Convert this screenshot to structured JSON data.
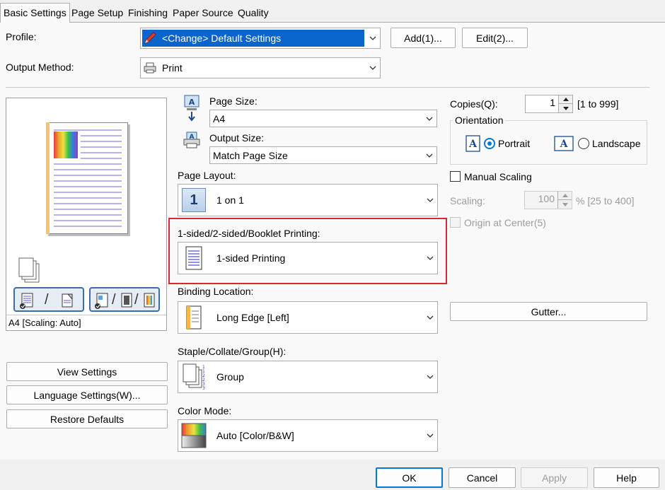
{
  "tabs": [
    {
      "label": "Basic Settings",
      "active": true
    },
    {
      "label": "Page Setup"
    },
    {
      "label": "Finishing"
    },
    {
      "label": "Paper Source"
    },
    {
      "label": "Quality"
    }
  ],
  "profile": {
    "label": "Profile:",
    "value": "<Change> Default Settings",
    "add_label": "Add(1)...",
    "edit_label": "Edit(2)..."
  },
  "output_method": {
    "label": "Output Method:",
    "value": "Print"
  },
  "preview": {
    "status": "A4 [Scaling: Auto]"
  },
  "page_size": {
    "label": "Page Size:",
    "value": "A4"
  },
  "output_size": {
    "label": "Output Size:",
    "value": "Match Page Size"
  },
  "page_layout": {
    "label": "Page Layout:",
    "value": "1 on 1",
    "icon_text": "1"
  },
  "sided": {
    "label": "1-sided/2-sided/Booklet Printing:",
    "value": "1-sided Printing"
  },
  "binding": {
    "label": "Binding Location:",
    "value": "Long Edge [Left]"
  },
  "staple": {
    "label": "Staple/Collate/Group(H):",
    "value": "Group"
  },
  "color_mode": {
    "label": "Color Mode:",
    "value": "Auto [Color/B&W]"
  },
  "copies": {
    "label": "Copies(Q):",
    "value": "1",
    "range": "[1 to 999]"
  },
  "orientation": {
    "label": "Orientation",
    "portrait": "Portrait",
    "landscape": "Landscape",
    "selected": "Portrait"
  },
  "manual_scaling": {
    "label": "Manual Scaling",
    "checked": false
  },
  "scaling": {
    "label": "Scaling:",
    "value": "100",
    "range": "% [25 to 400]"
  },
  "origin_center": {
    "label": "Origin at Center(5)"
  },
  "gutter_label": "Gutter...",
  "left_buttons": {
    "view": "View Settings",
    "language": "Language Settings(W)...",
    "restore": "Restore Defaults"
  },
  "dialog_buttons": {
    "ok": "OK",
    "cancel": "Cancel",
    "apply": "Apply",
    "help": "Help"
  },
  "colors": {
    "accent": "#0078d7",
    "highlight": "#d9282f",
    "profile_bg": "#0a64c9"
  }
}
